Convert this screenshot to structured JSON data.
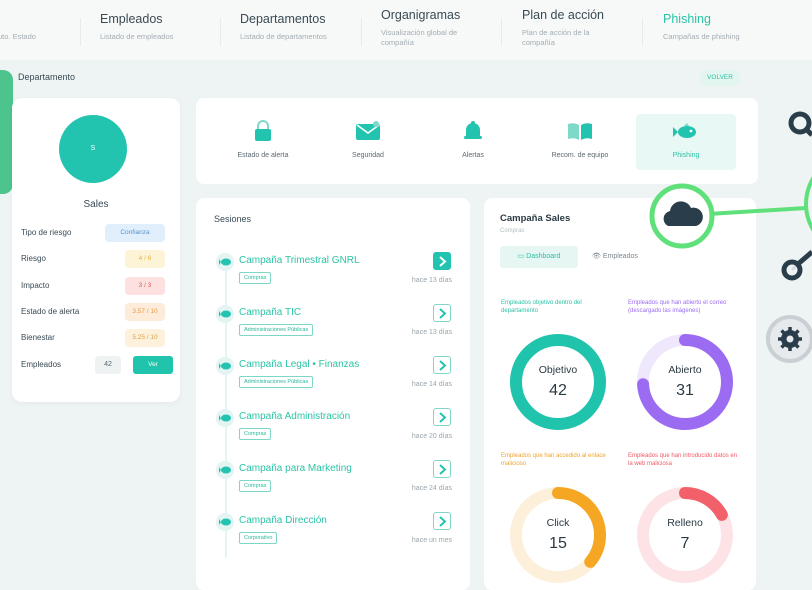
{
  "nav": [
    {
      "title": "",
      "sub": "uto. Estado"
    },
    {
      "title": "Empleados",
      "sub": "Listado de empleados"
    },
    {
      "title": "Departamentos",
      "sub": "Listado de departamentos"
    },
    {
      "title": "Organigramas",
      "sub": "Visualización global de compañía"
    },
    {
      "title": "Plan de acción",
      "sub": "Plan de acción de la compañía"
    },
    {
      "title": "Phishing",
      "sub": "Campañas de phishing"
    }
  ],
  "page": {
    "section_label": "Departamento",
    "back_label": "VOLVER"
  },
  "department": {
    "avatar_initial": "S",
    "name": "Sales",
    "rows": [
      {
        "key": "Tipo de riesgo",
        "value": "Confianza"
      },
      {
        "key": "Riesgo",
        "value": "4 / 6"
      },
      {
        "key": "Impacto",
        "value": "3 / 3"
      },
      {
        "key": "Estado de alerta",
        "value": "3.57 / 10"
      },
      {
        "key": "Bienestar",
        "value": "5.25 / 10"
      }
    ],
    "employees_label": "Empleados",
    "employees_count": "42",
    "view_label": "Ver"
  },
  "categories": [
    {
      "label": "Estado de alerta",
      "icon": "lock-icon"
    },
    {
      "label": "Seguridad",
      "icon": "envelope-icon"
    },
    {
      "label": "Alertas",
      "icon": "bell-icon"
    },
    {
      "label": "Recom. de equipo",
      "icon": "book-icon"
    },
    {
      "label": "Phishing",
      "icon": "fish-icon"
    }
  ],
  "sessions": {
    "title": "Sesiones",
    "items": [
      {
        "name": "Campaña Trimestral GNRL",
        "tag": "Compras",
        "ago": "hace 13 días"
      },
      {
        "name": "Campaña TIC",
        "tag": "Administraciones Públicas",
        "ago": "hace 13 días"
      },
      {
        "name": "Campaña Legal • Finanzas",
        "tag": "Administraciones Públicas",
        "ago": "hace 14 días"
      },
      {
        "name": "Campaña Administración",
        "tag": "Compras",
        "ago": "hace 20 días"
      },
      {
        "name": "Campaña para Marketing",
        "tag": "Compras",
        "ago": "hace 24 días"
      },
      {
        "name": "Campaña Dirección",
        "tag": "Corporativo",
        "ago": "hace un mes"
      }
    ]
  },
  "campaign": {
    "title": "Campaña Sales",
    "subtitle": "Compras",
    "tab_dashboard": "Dashboard",
    "tab_employees": "Empleados",
    "metrics": [
      {
        "caption": "Empleados objetivo dentro del departamento",
        "label": "Objetivo",
        "value": 42,
        "fraction": 1.0,
        "color": "#20c3ab",
        "track": "#dff5f1",
        "caption_color": "#2bc3a6"
      },
      {
        "caption": "Empleados que han abierto el correo (descargado las imágenes)",
        "label": "Abierto",
        "value": 31,
        "fraction": 0.74,
        "color": "#9b6cf2",
        "track": "#efe8fd",
        "caption_color": "#9b6cf2"
      },
      {
        "caption": "Empleados que han accedido al enlace malicioso",
        "label": "Click",
        "value": 15,
        "fraction": 0.36,
        "color": "#f5a623",
        "track": "#fdf0da",
        "caption_color": "#f0a330"
      },
      {
        "caption": "Empleados que han introducido datos en la web maliciosa",
        "label": "Relleno",
        "value": 7,
        "fraction": 0.17,
        "color": "#f2606a",
        "track": "#fde3e5",
        "caption_color": "#ee5a64"
      }
    ]
  },
  "colors": {
    "accent": "#20c3ab",
    "active_nav": "#2bc3a6",
    "deco_green": "#5fe07a",
    "deco_dark": "#2a3d4a"
  }
}
